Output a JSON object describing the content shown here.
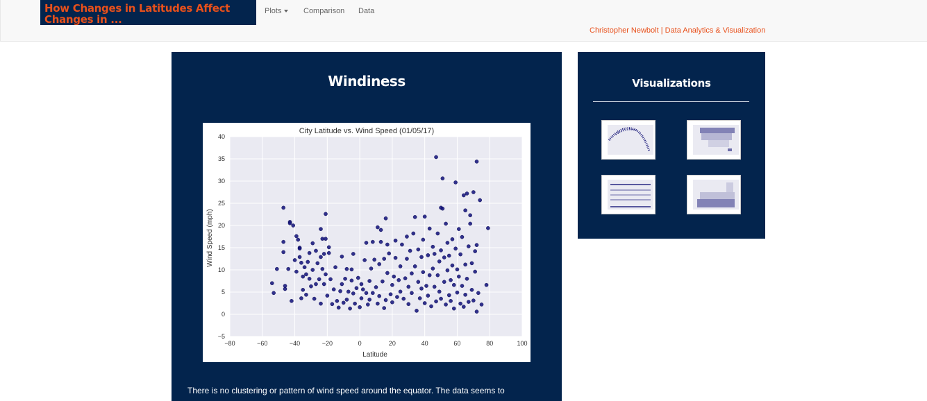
{
  "navbar": {
    "brand": "How Changes in Latitudes Affect Changes in ...",
    "items": [
      {
        "label": "Plots",
        "has_dropdown": true
      },
      {
        "label": "Comparison",
        "has_dropdown": false
      },
      {
        "label": "Data",
        "has_dropdown": false
      }
    ],
    "right_text": "Christopher Newbolt | Data Analytics & Visualization"
  },
  "colors": {
    "navy": "#03244d",
    "accent_orange": "#e8501b",
    "plot_background": "#eaeaf2",
    "point_color": "#0f0f7a"
  },
  "main_panel": {
    "title": "Windiness",
    "description": "There is no clustering or pattern of wind speed around the equator. The data seems to"
  },
  "side_panel": {
    "title": "Visualizations",
    "thumbnails": [
      {
        "name": "thumbnail-max-temp"
      },
      {
        "name": "thumbnail-humidity"
      },
      {
        "name": "thumbnail-cloudiness"
      },
      {
        "name": "thumbnail-wind-speed"
      }
    ]
  },
  "chart_data": {
    "type": "scatter",
    "title": "City Latitude vs. Wind Speed (01/05/17)",
    "xlabel": "Latitude",
    "ylabel": "Wind Speed (mph)",
    "xlim": [
      -80,
      100
    ],
    "ylim": [
      -5,
      40
    ],
    "xticks": [
      -80,
      -60,
      -40,
      -20,
      0,
      20,
      40,
      60,
      80,
      100
    ],
    "yticks": [
      -5,
      0,
      5,
      10,
      15,
      20,
      25,
      30,
      35,
      40
    ],
    "grid": true,
    "series": [
      {
        "points": [
          [
            -54,
            7
          ],
          [
            -53,
            4.8
          ],
          [
            -51,
            10.2
          ],
          [
            -47,
            24
          ],
          [
            -47,
            16.3
          ],
          [
            -47,
            14
          ],
          [
            -46,
            6.4
          ],
          [
            -46,
            5.7
          ],
          [
            -44,
            10.2
          ],
          [
            -43,
            20.8
          ],
          [
            -43,
            20.5
          ],
          [
            -42,
            3
          ],
          [
            -41,
            20
          ],
          [
            -40,
            12.2
          ],
          [
            -39,
            17.6
          ],
          [
            -39,
            9.6
          ],
          [
            -38,
            16.8
          ],
          [
            -37,
            15
          ],
          [
            -37,
            14.8
          ],
          [
            -37,
            12.9
          ],
          [
            -36,
            11.6
          ],
          [
            -36,
            3.6
          ],
          [
            -35,
            8.5
          ],
          [
            -35,
            5.5
          ],
          [
            -34,
            10.6
          ],
          [
            -33,
            9
          ],
          [
            -33,
            4.4
          ],
          [
            -32,
            11.8
          ],
          [
            -31,
            13.8
          ],
          [
            -31,
            8
          ],
          [
            -30,
            6.3
          ],
          [
            -29,
            16
          ],
          [
            -29,
            10
          ],
          [
            -28,
            3.5
          ],
          [
            -27,
            14.3
          ],
          [
            -27,
            6.8
          ],
          [
            -26,
            11.5
          ],
          [
            -25,
            7.9
          ],
          [
            -24,
            19.2
          ],
          [
            -24,
            12.9
          ],
          [
            -24,
            2.4
          ],
          [
            -23,
            17
          ],
          [
            -23,
            10.2
          ],
          [
            -22,
            13.6
          ],
          [
            -22,
            6.8
          ],
          [
            -21,
            22.6
          ],
          [
            -21,
            17
          ],
          [
            -21,
            9
          ],
          [
            -20,
            4.2
          ],
          [
            -19,
            15.1
          ],
          [
            -19,
            13.8
          ],
          [
            -18,
            7.9
          ],
          [
            -17,
            2.3
          ],
          [
            -16,
            5.6
          ],
          [
            -15,
            10.6
          ],
          [
            -14,
            3
          ],
          [
            -13,
            1.5
          ],
          [
            -12,
            5.2
          ],
          [
            -11,
            13
          ],
          [
            -11,
            6.8
          ],
          [
            -10,
            2.6
          ],
          [
            -9,
            8
          ],
          [
            -8,
            10.2
          ],
          [
            -8,
            3.3
          ],
          [
            -7,
            5.1
          ],
          [
            -6,
            1.3
          ],
          [
            -5,
            7.6
          ],
          [
            -5,
            10.1
          ],
          [
            -4,
            13.6
          ],
          [
            -4,
            4.7
          ],
          [
            -3,
            2.4
          ],
          [
            -2,
            5.9
          ],
          [
            -1,
            8.2
          ],
          [
            0,
            1.6
          ],
          [
            1,
            6.8
          ],
          [
            1,
            3.6
          ],
          [
            2,
            5.6
          ],
          [
            3,
            12.2
          ],
          [
            4,
            16.1
          ],
          [
            4,
            4.8
          ],
          [
            5,
            2.2
          ],
          [
            6,
            7.5
          ],
          [
            6,
            3.3
          ],
          [
            7,
            10.3
          ],
          [
            8,
            4.8
          ],
          [
            8,
            16.3
          ],
          [
            9,
            12.3
          ],
          [
            10,
            6.1
          ],
          [
            11,
            19.6
          ],
          [
            11,
            2.4
          ],
          [
            12,
            11.3
          ],
          [
            12,
            4.1
          ],
          [
            13,
            19
          ],
          [
            13,
            16.3
          ],
          [
            14,
            7.4
          ],
          [
            15,
            12.5
          ],
          [
            15,
            1.4
          ],
          [
            16,
            21.6
          ],
          [
            16,
            3.2
          ],
          [
            17,
            9.3
          ],
          [
            17,
            15.7
          ],
          [
            18,
            13.7
          ],
          [
            19,
            4.5
          ],
          [
            20,
            6.6
          ],
          [
            20,
            2.7
          ],
          [
            21,
            8.5
          ],
          [
            22,
            12.7
          ],
          [
            22,
            16.6
          ],
          [
            23,
            3.9
          ],
          [
            24,
            7.7
          ],
          [
            25,
            10.8
          ],
          [
            25,
            5.1
          ],
          [
            26,
            15.7
          ],
          [
            27,
            3.5
          ],
          [
            28,
            8.1
          ],
          [
            29,
            12.5
          ],
          [
            29,
            17.5
          ],
          [
            30,
            6.2
          ],
          [
            30,
            2.3
          ],
          [
            31,
            14.3
          ],
          [
            32,
            9.2
          ],
          [
            32,
            4.8
          ],
          [
            33,
            18.2
          ],
          [
            34,
            10.8
          ],
          [
            34,
            21.9
          ],
          [
            35,
            0.8
          ],
          [
            36,
            7.3
          ],
          [
            36,
            14.6
          ],
          [
            37,
            3.6
          ],
          [
            38,
            12.9
          ],
          [
            38,
            5.8
          ],
          [
            39,
            16.8
          ],
          [
            39,
            9.5
          ],
          [
            40,
            2.5
          ],
          [
            40,
            22
          ],
          [
            41,
            6.4
          ],
          [
            42,
            13.3
          ],
          [
            42,
            4.2
          ],
          [
            43,
            8.8
          ],
          [
            43,
            19.3
          ],
          [
            44,
            1.8
          ],
          [
            45,
            10.3
          ],
          [
            45,
            15.2
          ],
          [
            46,
            6.2
          ],
          [
            46,
            13.6
          ],
          [
            47,
            2.9
          ],
          [
            47,
            35.4
          ],
          [
            48,
            8.8
          ],
          [
            48,
            18.2
          ],
          [
            49,
            5.1
          ],
          [
            49,
            11.9
          ],
          [
            50,
            24
          ],
          [
            50,
            14.4
          ],
          [
            50,
            3.5
          ],
          [
            51,
            30.6
          ],
          [
            51,
            23.8
          ],
          [
            52,
            7.3
          ],
          [
            52,
            12.8
          ],
          [
            53,
            2.2
          ],
          [
            53,
            20.4
          ],
          [
            54,
            9.9
          ],
          [
            54,
            16.1
          ],
          [
            55,
            4.3
          ],
          [
            55,
            13.2
          ],
          [
            56,
            7.7
          ],
          [
            56,
            3
          ],
          [
            57,
            11
          ],
          [
            57,
            16.9
          ],
          [
            58,
            1.3
          ],
          [
            58,
            6.6
          ],
          [
            59,
            14.8
          ],
          [
            59,
            29.7
          ],
          [
            60,
            10.1
          ],
          [
            60,
            4.9
          ],
          [
            61,
            8.5
          ],
          [
            61,
            19.2
          ],
          [
            62,
            2.4
          ],
          [
            62,
            13.5
          ],
          [
            63,
            6.4
          ],
          [
            63,
            17.4
          ],
          [
            64,
            1.7
          ],
          [
            64,
            26.8
          ],
          [
            65,
            23.4
          ],
          [
            65,
            11.2
          ],
          [
            65,
            4.4
          ],
          [
            66,
            27.2
          ],
          [
            66,
            8
          ],
          [
            67,
            15.3
          ],
          [
            67,
            2.8
          ],
          [
            68,
            20.4
          ],
          [
            68,
            22.3
          ],
          [
            69,
            5.5
          ],
          [
            69,
            11.5
          ],
          [
            70,
            3.1
          ],
          [
            70,
            27.5
          ],
          [
            71,
            14.2
          ],
          [
            71,
            9.6
          ],
          [
            72,
            34.4
          ],
          [
            72,
            15.6
          ],
          [
            72,
            0.6
          ],
          [
            73,
            4.8
          ],
          [
            74,
            25.7
          ],
          [
            75,
            2.2
          ],
          [
            78,
            6.6
          ],
          [
            79,
            19.4
          ]
        ]
      }
    ]
  }
}
